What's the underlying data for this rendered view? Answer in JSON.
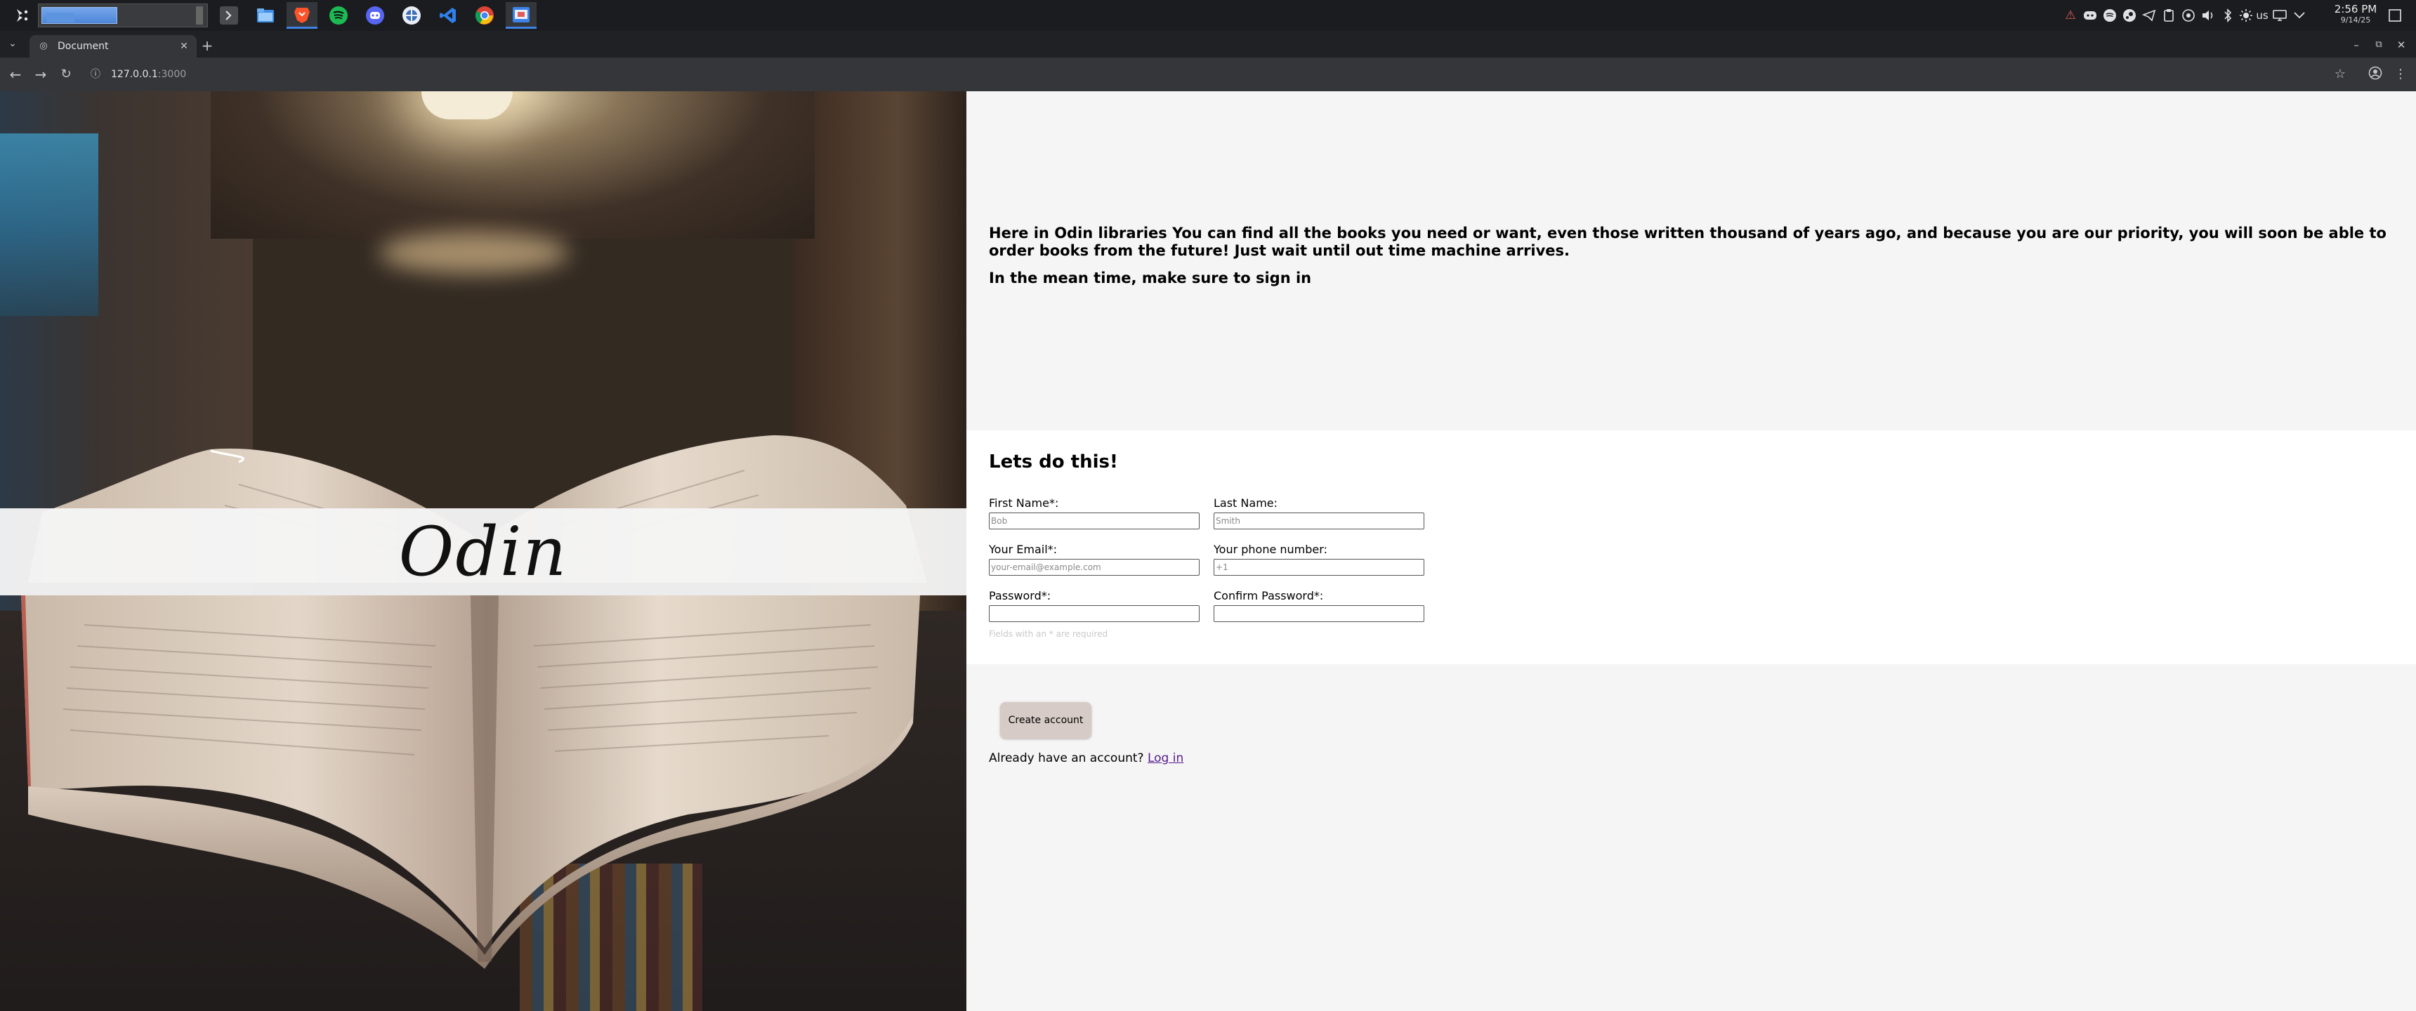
{
  "taskbar": {
    "apps": [
      {
        "name": "terminal",
        "icon": "terminal-icon",
        "color": "#3a3b3e"
      },
      {
        "name": "files",
        "icon": "folder-icon",
        "color": "#3d8ee6"
      },
      {
        "name": "brave",
        "icon": "brave-icon",
        "color": "#fb542b"
      },
      {
        "name": "spotify",
        "icon": "spotify-icon",
        "color": "#1db954"
      },
      {
        "name": "discord",
        "icon": "discord-icon",
        "color": "#5865f2"
      },
      {
        "name": "flatpak",
        "icon": "bug-icon",
        "color": "#3d6fb6"
      },
      {
        "name": "vscode",
        "icon": "vscode-icon",
        "color": "#2f80ed"
      },
      {
        "name": "chrome",
        "icon": "chrome-icon",
        "color": "#34a853"
      },
      {
        "name": "screenshot",
        "icon": "screenshot-icon",
        "color": "#3d82e6"
      }
    ],
    "tray": {
      "language": "us"
    },
    "clock": {
      "time": "2:56 PM",
      "date": "9/14/25"
    }
  },
  "browser": {
    "tab_title": "Document",
    "url_host": "127.0.0.1",
    "url_port": ":3000"
  },
  "hero": {
    "title": "Odin"
  },
  "intro": {
    "paragraph1": "Here in Odin libraries You can find all the books you need or want, even those written thousand of years ago, and because you are our priority, you will soon be able to order books from the future! Just wait until out time machine arrives.",
    "paragraph2": "In the mean time, make sure to sign in"
  },
  "form": {
    "title": "Lets do this!",
    "first_name": {
      "label": "First Name*:",
      "placeholder": "Bob"
    },
    "last_name": {
      "label": "Last Name:",
      "placeholder": "Smith"
    },
    "email": {
      "label": "Your Email*:",
      "placeholder": "your-email@example.com"
    },
    "phone": {
      "label": "Your phone number:",
      "placeholder": "+1"
    },
    "password": {
      "label": "Password*:",
      "placeholder": ""
    },
    "confirm_password": {
      "label": "Confirm Password*:",
      "placeholder": ""
    },
    "required_note": "Fields with an * are required"
  },
  "actions": {
    "create_label": "Create account",
    "login_prompt": "Already have an account?",
    "login_link": "Log in"
  },
  "colors": {
    "panel_bg": "#f5f5f5",
    "form_bg": "#ffffff",
    "button_bg": "#d6cbc6",
    "link": "#551a8b",
    "browser_toolbar": "#35363a"
  }
}
